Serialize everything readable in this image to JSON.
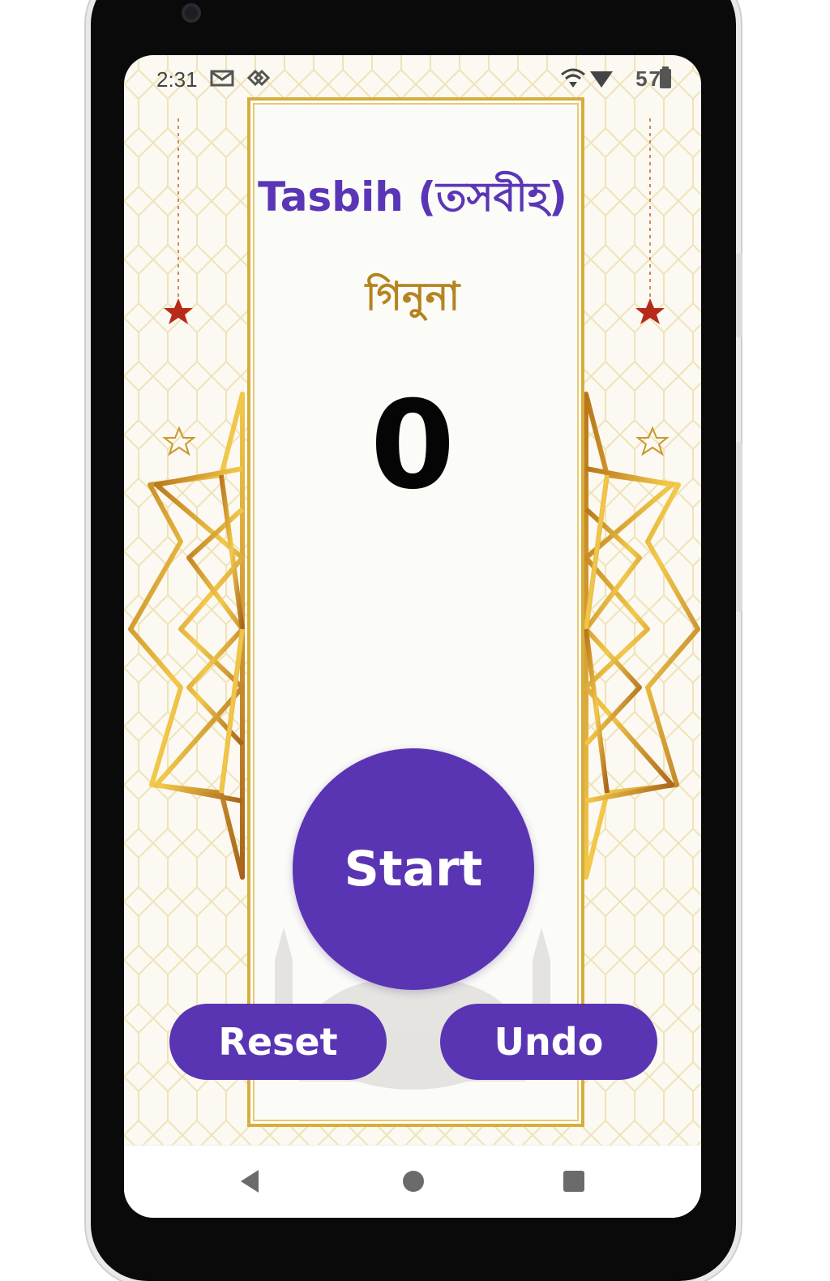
{
  "status_bar": {
    "time": "2:31",
    "battery": "57",
    "icons": [
      "mail-icon",
      "sync-icon",
      "wifi-icon",
      "signal-icon",
      "battery-icon"
    ]
  },
  "app": {
    "title": "Tasbih (তসবীহ)",
    "subtitle": "গিনুনা",
    "count": "0"
  },
  "buttons": {
    "start": "Start",
    "reset": "Reset",
    "undo": "Undo"
  },
  "navigation": {
    "icons": [
      "back-icon",
      "home-icon",
      "recents-icon"
    ]
  },
  "colors": {
    "accent": "#5935b3",
    "gold": "#d8ad3c",
    "subtitle": "#b48420"
  }
}
